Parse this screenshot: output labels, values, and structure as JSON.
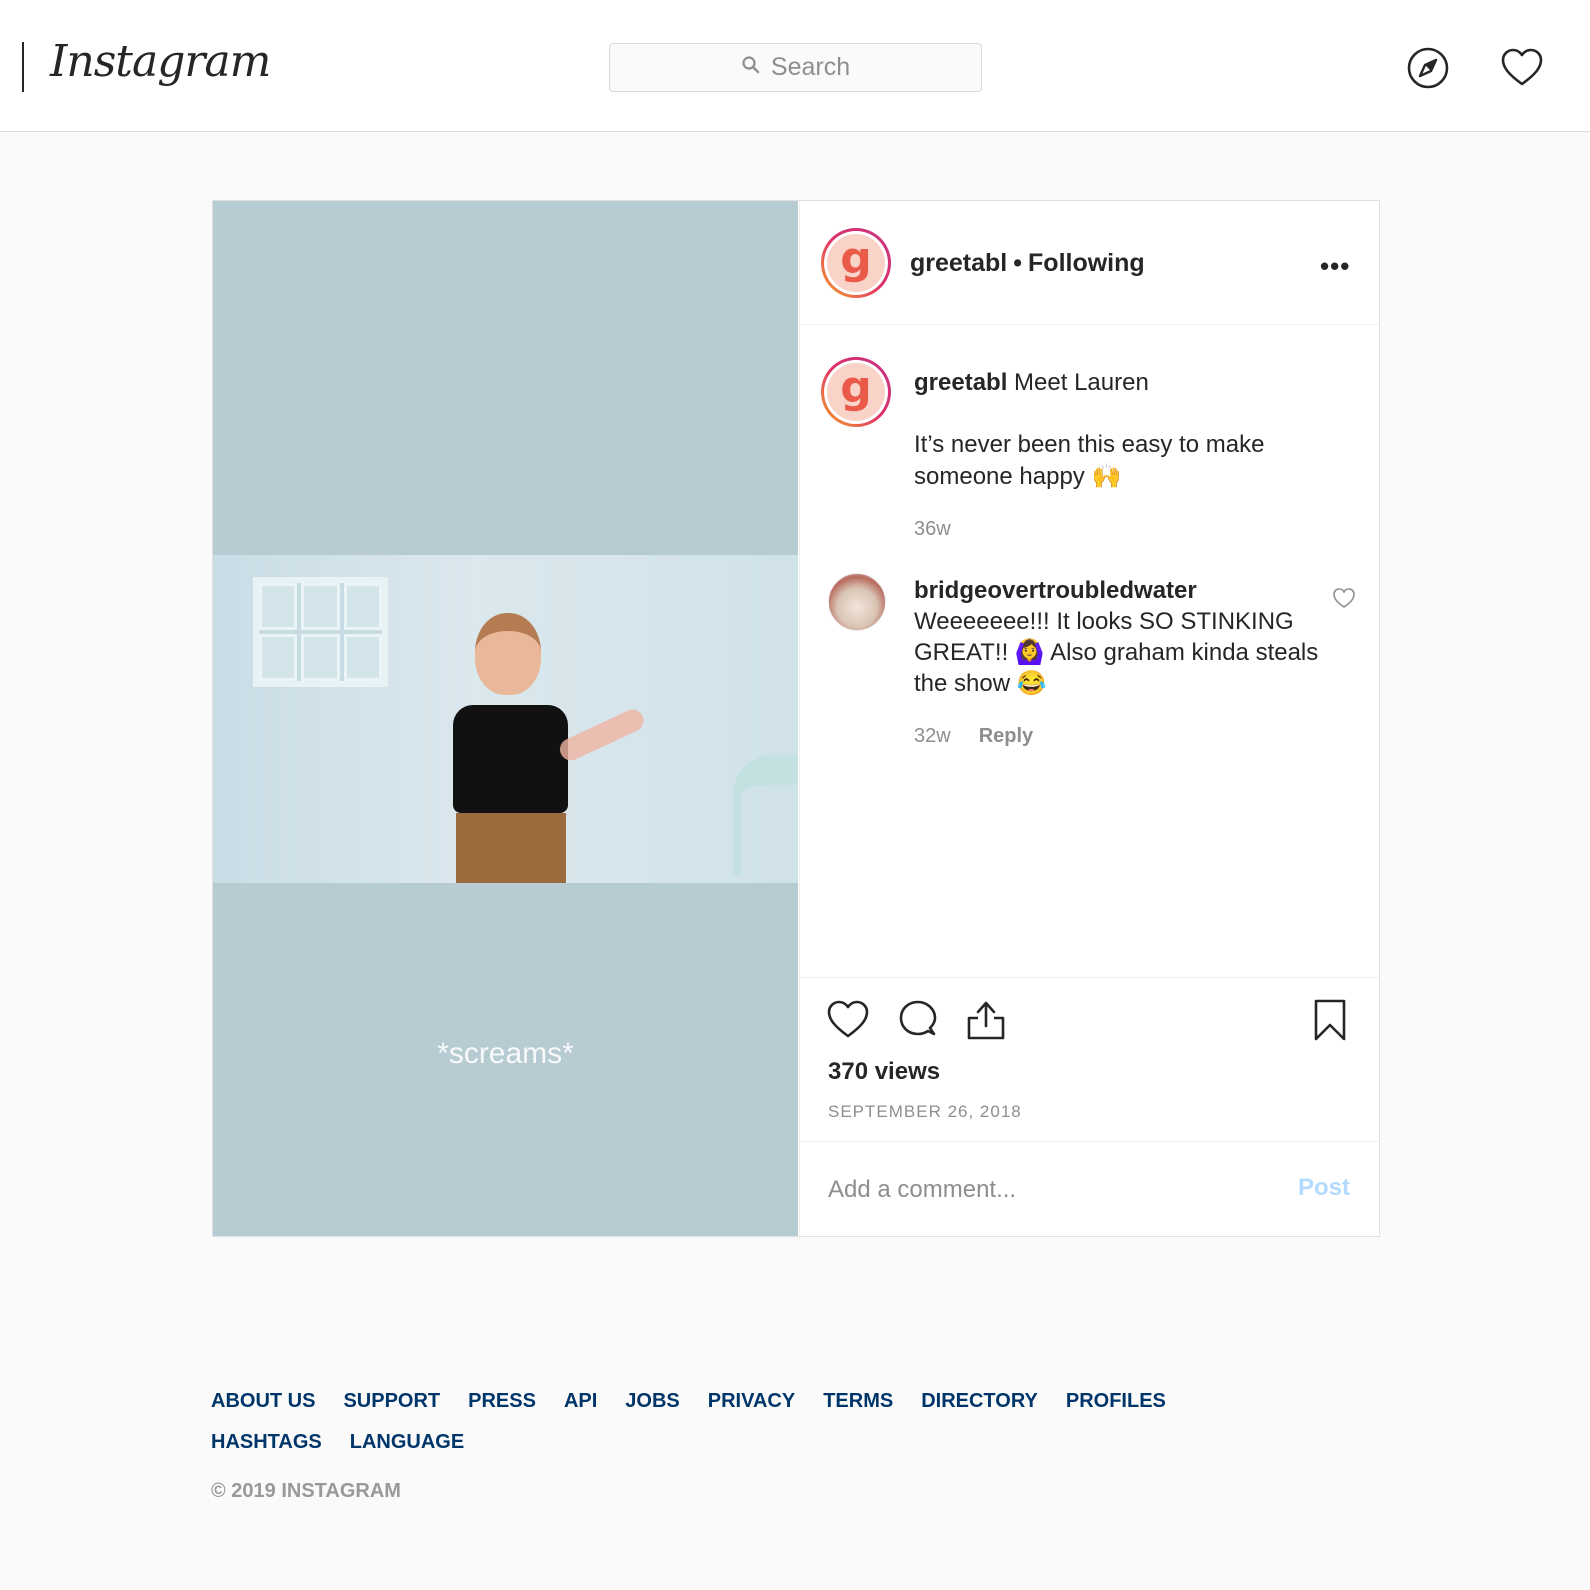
{
  "header": {
    "logo": "Instagram",
    "search_placeholder": "Search"
  },
  "post": {
    "media_overlay_text": "*screams*",
    "author": {
      "username": "greetabl",
      "follow_status": "Following",
      "avatar_letter": "g"
    },
    "more_label": "•••",
    "caption": {
      "username": "greetabl",
      "line1": "Meet Lauren",
      "line2": "It’s never been this easy to make someone happy 🙌",
      "time": "36w"
    },
    "comments": [
      {
        "username": "bridgeovertroubledwater",
        "text": "Weeeeeee!!! It looks SO STINKING GREAT!! 🙆‍♀️  Also graham kinda steals the show 😂",
        "time": "32w",
        "reply_label": "Reply"
      }
    ],
    "views": "370 views",
    "date": "SEPTEMBER 26, 2018",
    "comment_input": {
      "placeholder": "Add a comment...",
      "post_label": "Post"
    }
  },
  "footer": {
    "links": [
      "ABOUT US",
      "SUPPORT",
      "PRESS",
      "API",
      "JOBS",
      "PRIVACY",
      "TERMS",
      "DIRECTORY",
      "PROFILES",
      "HASHTAGS",
      "LANGUAGE"
    ],
    "copyright": "© 2019 INSTAGRAM"
  },
  "colors": {
    "link": "#003569",
    "post_button_disabled": "#b3dbff",
    "muted_text": "#8e8e8e"
  },
  "icons": [
    "search-icon",
    "compass-icon",
    "heart-icon",
    "like-icon",
    "comment-icon",
    "share-icon",
    "bookmark-icon"
  ]
}
